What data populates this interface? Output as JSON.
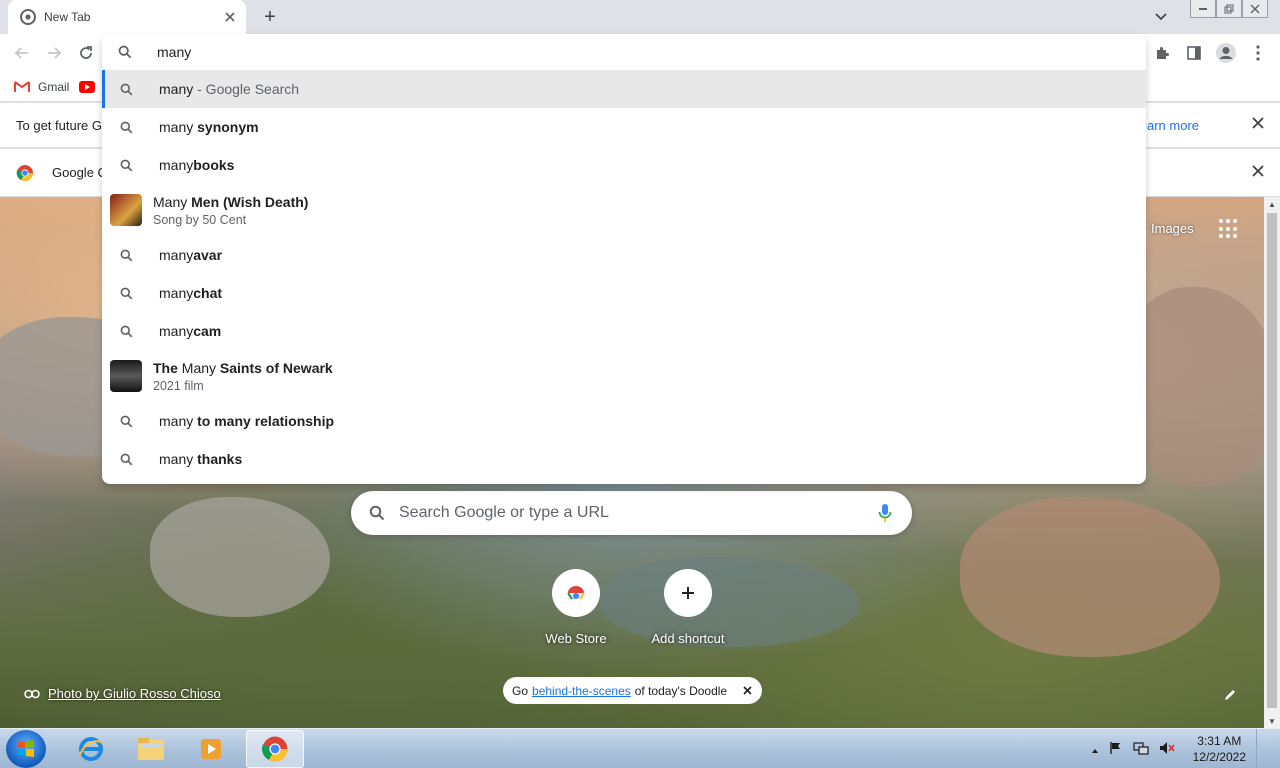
{
  "tab": {
    "title": "New Tab",
    "close_label": "×"
  },
  "toolbar": {
    "newtab_label": "+"
  },
  "bookmarks": {
    "items": [
      {
        "label": "Gmail"
      }
    ]
  },
  "infobar1": {
    "text": "To get future G",
    "learn_more": "Learn more"
  },
  "infobar2": {
    "text": "Google C"
  },
  "omnibox": {
    "input_value": "many",
    "suggestions": [
      {
        "type": "search",
        "plain": "many",
        "sub": " - Google Search",
        "bold": "",
        "selected": true
      },
      {
        "type": "search",
        "plain": "many ",
        "bold": "synonym"
      },
      {
        "type": "search",
        "plain": "many",
        "bold": "books"
      },
      {
        "type": "entity",
        "plain": "Many ",
        "bold": "Men (Wish Death)",
        "desc": "Song by 50 Cent"
      },
      {
        "type": "search",
        "plain": "many",
        "bold": "avar"
      },
      {
        "type": "search",
        "plain": "many",
        "bold": "chat"
      },
      {
        "type": "search",
        "plain": "many",
        "bold": "cam"
      },
      {
        "type": "entity",
        "pre_bold": "The ",
        "plain": "Many ",
        "bold": "Saints of Newark",
        "desc": "2021 film"
      },
      {
        "type": "search",
        "plain": "many ",
        "bold": "to many relationship"
      },
      {
        "type": "search",
        "plain": "many ",
        "bold": "thanks"
      }
    ]
  },
  "ntp": {
    "images_link": "Images",
    "search_placeholder": "Search Google or type a URL",
    "shortcuts": [
      {
        "label": "Web Store"
      },
      {
        "label": "Add shortcut"
      }
    ],
    "photo_credit": "Photo by Giulio Rosso Chioso",
    "doodle": {
      "pre": "Go ",
      "link": "behind-the-scenes",
      "post": " of today's Doodle"
    }
  },
  "taskbar": {
    "time": "3:31 AM",
    "date": "12/2/2022"
  },
  "colors": {
    "accent": "#1a73e8",
    "selected_row": "#e8e8e9"
  }
}
